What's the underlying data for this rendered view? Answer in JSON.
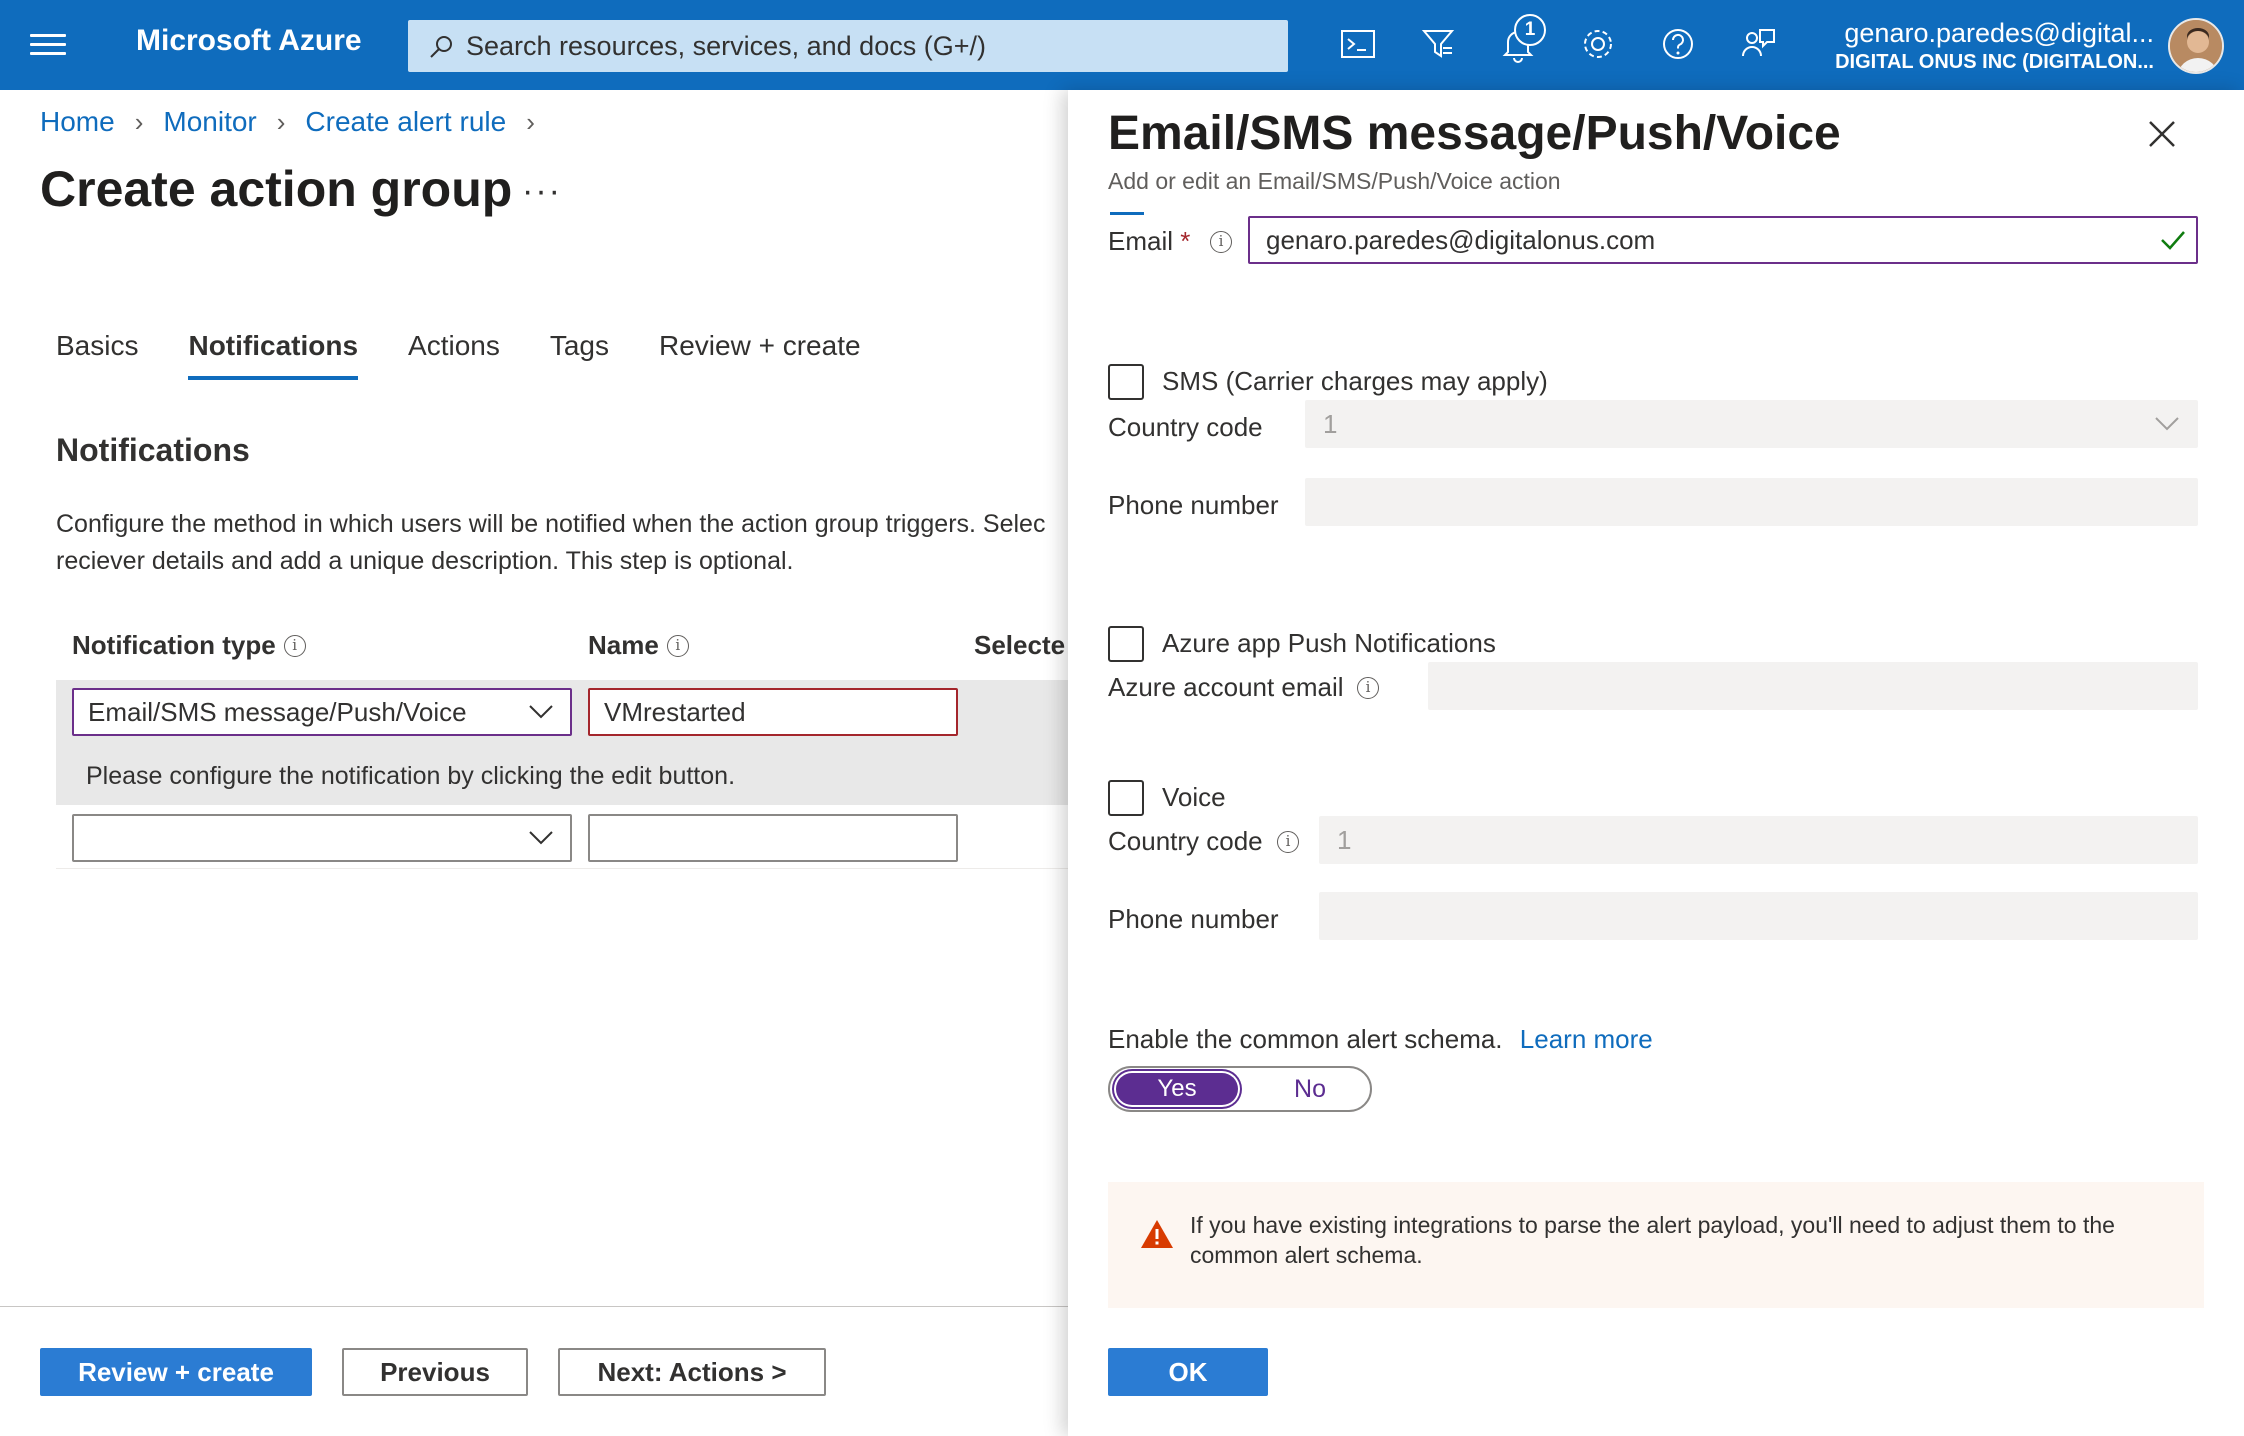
{
  "topbar": {
    "brand": "Microsoft Azure",
    "search_placeholder": "Search resources, services, and docs (G+/)",
    "notification_count": "1",
    "user_email": "genaro.paredes@digital...",
    "user_org": "DIGITAL ONUS INC (DIGITALON..."
  },
  "breadcrumb": [
    "Home",
    "Monitor",
    "Create alert rule"
  ],
  "page": {
    "title": "Create action group",
    "more": "···"
  },
  "tabs": [
    "Basics",
    "Notifications",
    "Actions",
    "Tags",
    "Review + create"
  ],
  "notifications": {
    "section_title": "Notifications",
    "description_line1": "Configure the method in which users will be notified when the action group triggers. Selec",
    "description_line2": "reciever details and add a unique description. This step is optional.",
    "col_type": "Notification type",
    "col_name": "Name",
    "col_selected": "Selecte",
    "row1_type": "Email/SMS message/Push/Voice",
    "row1_name": "VMrestarted",
    "row1_note": "Please configure the notification by clicking the edit button.",
    "row2_type": "",
    "row2_name": ""
  },
  "footer": {
    "review_create": "Review + create",
    "previous": "Previous",
    "next": "Next: Actions >"
  },
  "panel": {
    "title": "Email/SMS message/Push/Voice",
    "subtitle": "Add or edit an Email/SMS/Push/Voice action",
    "email_label": "Email",
    "email_required": "*",
    "email_value": "genaro.paredes@digitalonus.com",
    "sms_label": "SMS (Carrier charges may apply)",
    "sms_country_code_label": "Country code",
    "sms_country_code_value": "1",
    "sms_phone_label": "Phone number",
    "push_label": "Azure app Push Notifications",
    "push_email_label": "Azure account email",
    "voice_label": "Voice",
    "voice_country_code_label": "Country code",
    "voice_country_code_value": "1",
    "voice_phone_label": "Phone number",
    "schema_label": "Enable the common alert schema.",
    "learn_more": "Learn more",
    "toggle_yes": "Yes",
    "toggle_no": "No",
    "warning": "If you have existing integrations to parse the alert payload, you'll need to adjust them to the common alert schema.",
    "ok": "OK"
  },
  "colors": {
    "header_blue": "#0f6cbd",
    "primary_button": "#2b7cd3",
    "toggle_purple": "#5c2d91",
    "error_red": "#a4262c",
    "warning_orange": "#d83b01"
  }
}
